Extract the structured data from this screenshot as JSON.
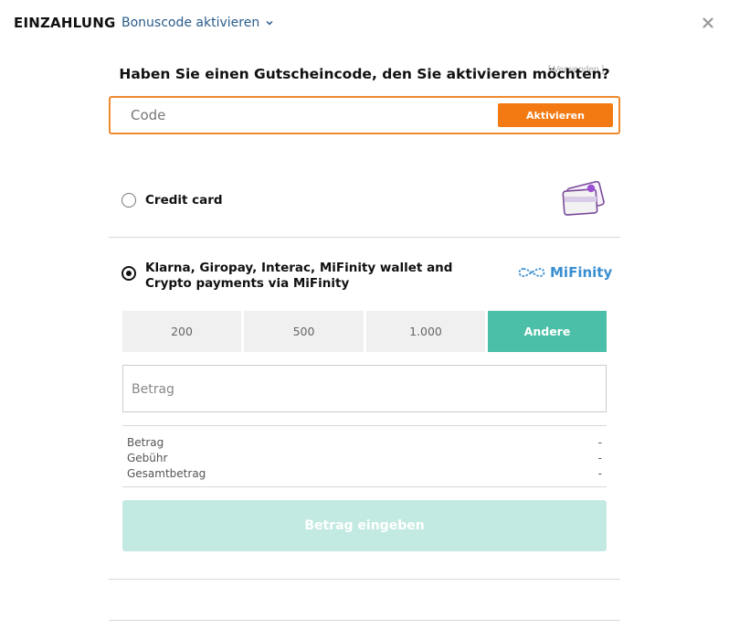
{
  "header": {
    "title": "EINZAHLUNG",
    "bonus_link": "Bonuscode aktivieren"
  },
  "voucher": {
    "question": "Haben Sie einen Gutscheincode, den Sie aktivieren möchten?",
    "hint": "[ Verwenden ]",
    "placeholder": "Code",
    "activate_label": "Aktivieren"
  },
  "methods": [
    {
      "label": "Credit card",
      "selected": false,
      "icon": "credit-card-stack-icon"
    },
    {
      "label": "Klarna, Giropay, Interac, MiFinity wallet and Crypto payments via MiFinity",
      "selected": true,
      "logo_text": "MiFinity",
      "icon": "mifinity-logo"
    }
  ],
  "amounts": {
    "options": [
      "200",
      "500",
      "1.000",
      "Andere"
    ],
    "selected": "Andere"
  },
  "amount_input": {
    "placeholder": "Betrag"
  },
  "summary": [
    {
      "label": "Betrag",
      "value": "-"
    },
    {
      "label": "Gebühr",
      "value": "-"
    },
    {
      "label": "Gesamtbetrag",
      "value": "-"
    }
  ],
  "submit_label": "Betrag eingeben",
  "colors": {
    "accent_orange": "#f37a12",
    "teal": "#4bbfa7",
    "teal_disabled": "#c3eae2",
    "link_blue": "#2a5c8a",
    "mifinity_blue": "#3a8fd1"
  }
}
